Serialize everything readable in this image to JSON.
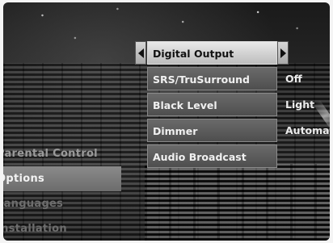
{
  "left_menu": {
    "items": [
      {
        "label": "Parental Control"
      },
      {
        "label": "Options"
      },
      {
        "label": "Languages"
      },
      {
        "label": "Installation"
      }
    ]
  },
  "sub_menu": {
    "items": [
      {
        "label": "Digital Output",
        "value": ""
      },
      {
        "label": "SRS/TruSurround",
        "value": "Off"
      },
      {
        "label": "Black Level",
        "value": "Light"
      },
      {
        "label": "Dimmer",
        "value": "Automatic"
      },
      {
        "label": "Audio Broadcast",
        "value": ""
      }
    ]
  },
  "icons": {
    "left_arrow": "triangle-left-icon",
    "right_arrow": "triangle-right-icon"
  },
  "colors": {
    "selected_bg": "#d9d9d9",
    "item_bg": "#5c5c5c",
    "text": "#f0f0f0"
  }
}
